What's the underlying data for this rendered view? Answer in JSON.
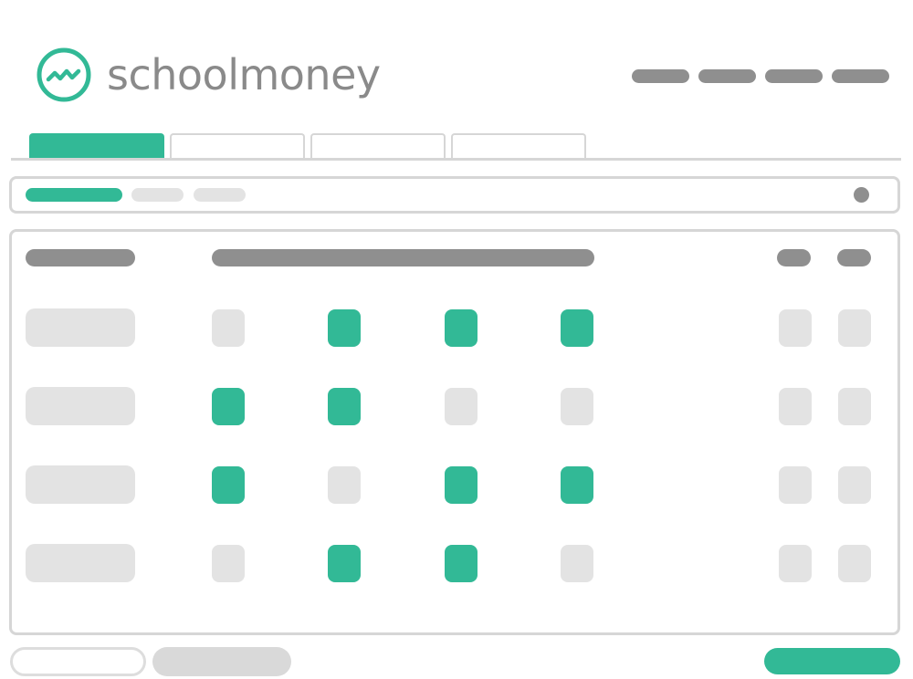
{
  "header": {
    "brand_name": "schoolmoney",
    "logo_icon": "pulse-circle-icon"
  },
  "colors": {
    "accent": "#32b996",
    "dark_placeholder": "#8f8f8f",
    "light_placeholder": "#e3e3e3",
    "border": "#d6d6d6"
  },
  "tabs": [
    {
      "active": true
    },
    {
      "active": false
    },
    {
      "active": false
    },
    {
      "active": false
    }
  ],
  "filters": [
    {
      "active": true
    },
    {
      "active": false
    },
    {
      "active": false
    }
  ],
  "grid": {
    "columns": 4,
    "rows": [
      [
        false,
        true,
        true,
        true
      ],
      [
        true,
        true,
        false,
        false
      ],
      [
        true,
        false,
        true,
        true
      ],
      [
        false,
        true,
        true,
        false
      ]
    ]
  }
}
